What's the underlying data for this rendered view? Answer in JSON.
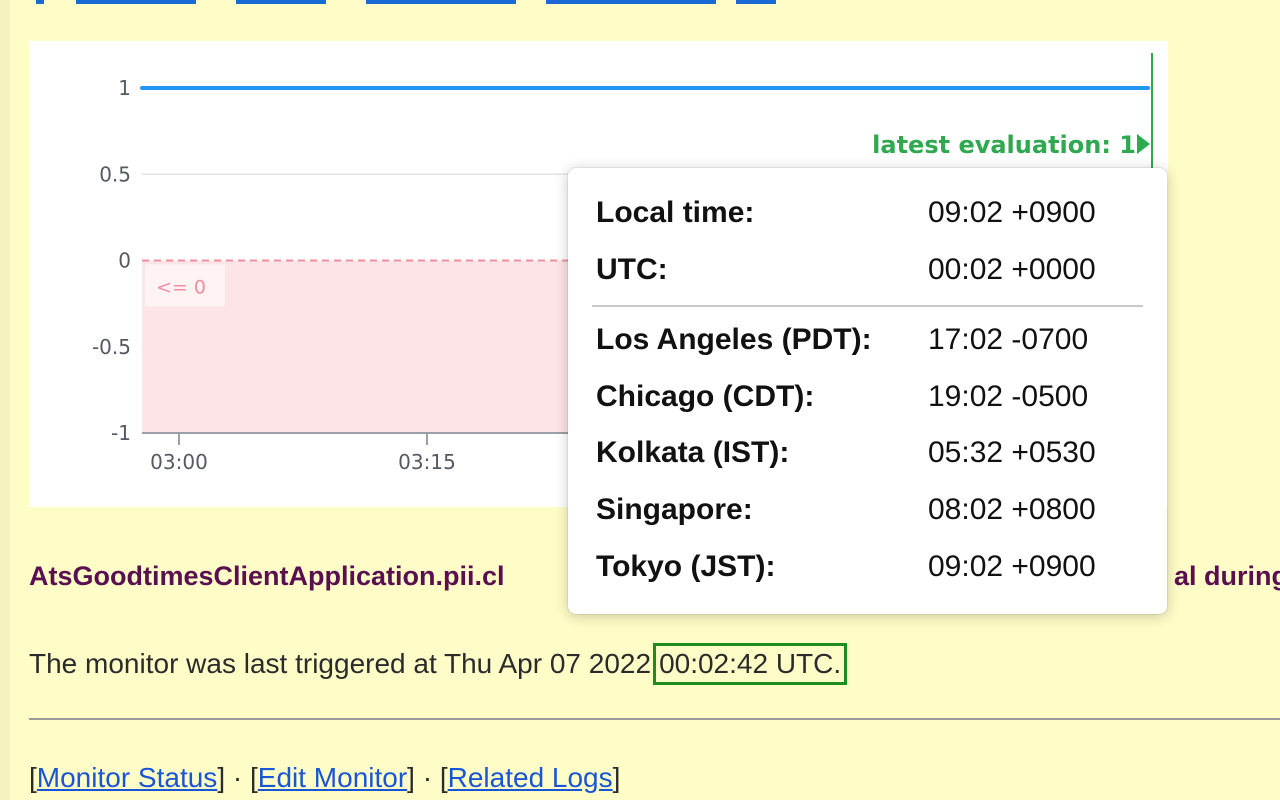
{
  "chart_data": {
    "type": "line",
    "x_ticks": [
      "03:00",
      "03:15"
    ],
    "y_ticks": [
      "1",
      "0.5",
      "0",
      "-0.5",
      "-1"
    ],
    "ylim": [
      -1,
      1
    ],
    "series": [
      {
        "x": [
          "03:00",
          "latest"
        ],
        "y": [
          1,
          1
        ],
        "color": "#2196f3"
      }
    ],
    "threshold": {
      "label": "<= 0",
      "value": 0,
      "color": "#f18fa0",
      "fill": "#fde4e6"
    },
    "annotation": "latest evaluation: 1"
  },
  "monitor": {
    "title_left": "AtsGoodtimesClientApplication.pii.cl",
    "title_right": "al during",
    "trigger_prefix": "The monitor was last triggered at Thu Apr 07 2022",
    "trigger_time": "00:02:42 UTC."
  },
  "links": {
    "monitor_status": "Monitor Status",
    "edit_monitor": "Edit Monitor",
    "related_logs": "Related Logs",
    "separator": "·"
  },
  "tooltip": {
    "rows_top": [
      {
        "label": "Local time:",
        "value": "09:02 +0900"
      },
      {
        "label": "UTC:",
        "value": "00:02 +0000"
      }
    ],
    "rows_bottom": [
      {
        "label": "Los Angeles (PDT):",
        "value": "17:02 -0700"
      },
      {
        "label": "Chicago (CDT):",
        "value": "19:02 -0500"
      },
      {
        "label": "Kolkata (IST):",
        "value": "05:32 +0530"
      },
      {
        "label": "Singapore:",
        "value": "08:02 +0800"
      },
      {
        "label": "Tokyo (JST):",
        "value": "09:02 +0900"
      }
    ]
  },
  "colors": {
    "page_bg": "#fefdc7",
    "series": "#2196f3",
    "latest_eval": "#2fa84f",
    "highlight_box": "#1e8c1e",
    "link": "#1a55d6",
    "title": "#5a1050"
  }
}
